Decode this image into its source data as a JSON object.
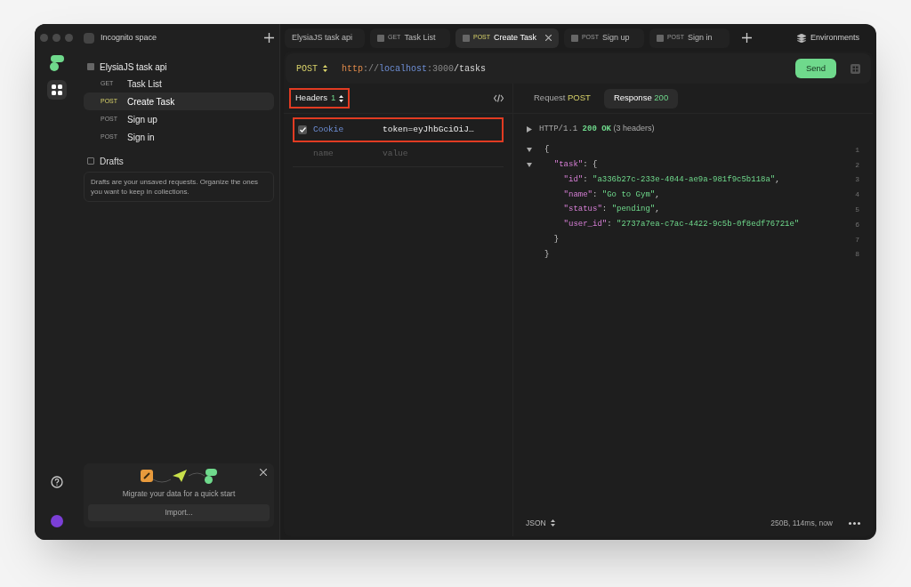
{
  "workspace": {
    "title": "Incognito space"
  },
  "tabs": [
    {
      "label": "ElysiaJS task api",
      "selected": false
    },
    {
      "method": "GET",
      "label": "Task List",
      "selected": false
    },
    {
      "method": "POST",
      "label": "Create Task",
      "selected": true
    },
    {
      "method": "POST",
      "label": "Sign up",
      "selected": false
    },
    {
      "method": "POST",
      "label": "Sign in",
      "selected": false
    }
  ],
  "environments": "Environments",
  "collection": {
    "name": "ElysiaJS task api",
    "items": [
      {
        "method": "GET",
        "label": "Task List",
        "selected": false
      },
      {
        "method": "POST",
        "label": "Create Task",
        "selected": true
      },
      {
        "method": "POST",
        "label": "Sign up",
        "selected": false
      },
      {
        "method": "POST",
        "label": "Sign in",
        "selected": false
      }
    ]
  },
  "drafts": {
    "title": "Drafts",
    "note": "Drafts are your unsaved requests. Organize the ones you want to keep in collections."
  },
  "migrate": {
    "text": "Migrate your data for a quick start",
    "button": "Import..."
  },
  "request": {
    "method": "POST",
    "url": [
      {
        "kind": "scheme",
        "text": "http"
      },
      {
        "kind": "sep",
        "text": "://"
      },
      {
        "kind": "host",
        "text": "localhost"
      },
      {
        "kind": "sep",
        "text": ":3000"
      },
      {
        "kind": "path",
        "text": "/tasks"
      }
    ],
    "send": "Send"
  },
  "headers": {
    "label": "Headers",
    "count": "1",
    "rows": [
      {
        "name": "Cookie",
        "value": "token=eyJhbGciOiJ…",
        "checked": true
      }
    ],
    "placeholder_name": "name",
    "placeholder_value": "value"
  },
  "response_tabs": [
    {
      "label": "Request",
      "badge": "POST",
      "selected": false
    },
    {
      "label": "Response",
      "badge": "200",
      "selected": true
    }
  ],
  "status_line": {
    "protocol": "HTTP/1.1",
    "status": "200 OK",
    "headers": "(3 headers)"
  },
  "body": [
    {
      "number": "1",
      "fold": true,
      "tokens": [
        {
          "kind": "punct",
          "text": "{"
        }
      ]
    },
    {
      "number": "2",
      "fold": true,
      "tokens": [
        {
          "kind": "key",
          "text": "\"task\""
        },
        {
          "kind": "punct",
          "text": ": {"
        }
      ]
    },
    {
      "number": "3",
      "fold": false,
      "tokens": [
        {
          "kind": "key",
          "text": "\"id\""
        },
        {
          "kind": "punct",
          "text": ": "
        },
        {
          "kind": "string",
          "text": "\"a336b27c-233e-4044-ae9a-981f9c5b118a\""
        },
        {
          "kind": "punct",
          "text": ","
        }
      ]
    },
    {
      "number": "4",
      "fold": false,
      "tokens": [
        {
          "kind": "key",
          "text": "\"name\""
        },
        {
          "kind": "punct",
          "text": ": "
        },
        {
          "kind": "string",
          "text": "\"Go to Gym\""
        },
        {
          "kind": "punct",
          "text": ","
        }
      ]
    },
    {
      "number": "5",
      "fold": false,
      "tokens": [
        {
          "kind": "key",
          "text": "\"status\""
        },
        {
          "kind": "punct",
          "text": ": "
        },
        {
          "kind": "string",
          "text": "\"pending\""
        },
        {
          "kind": "punct",
          "text": ","
        }
      ]
    },
    {
      "number": "6",
      "fold": false,
      "tokens": [
        {
          "kind": "key",
          "text": "\"user_id\""
        },
        {
          "kind": "punct",
          "text": ": "
        },
        {
          "kind": "string",
          "text": "\"2737a7ea-c7ac-4422-9c5b-0f8edf76721e\""
        }
      ]
    },
    {
      "number": "7",
      "fold": false,
      "tokens": [
        {
          "kind": "punct",
          "text": "}"
        }
      ]
    },
    {
      "number": "8",
      "fold": false,
      "tokens": [
        {
          "kind": "punct",
          "text": "}"
        }
      ]
    }
  ],
  "footer": {
    "format": "JSON",
    "stats": "250B, 114ms, now"
  }
}
